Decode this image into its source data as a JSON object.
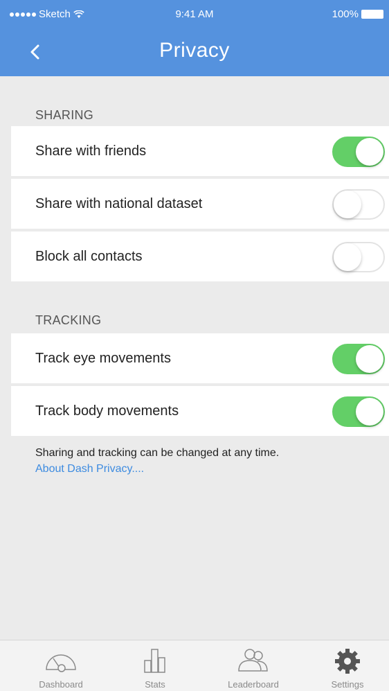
{
  "status_bar": {
    "carrier": "Sketch",
    "time": "9:41 AM",
    "battery": "100%"
  },
  "nav": {
    "back_icon": "chevron-left-icon",
    "title": "Privacy"
  },
  "sections": [
    {
      "header": "SHARING",
      "rows": [
        {
          "label": "Share with friends",
          "on": true
        },
        {
          "label": "Share with national dataset",
          "on": false
        },
        {
          "label": "Block all contacts",
          "on": false
        }
      ]
    },
    {
      "header": "TRACKING",
      "rows": [
        {
          "label": "Track eye movements",
          "on": true
        },
        {
          "label": "Track body movements",
          "on": true
        }
      ]
    }
  ],
  "footer": {
    "note": "Sharing and tracking can be changed at any time.",
    "link": "About Dash Privacy...."
  },
  "tabs": [
    {
      "label": "Dashboard",
      "icon": "gauge-icon"
    },
    {
      "label": "Stats",
      "icon": "bar-chart-icon"
    },
    {
      "label": "Leaderboard",
      "icon": "users-icon"
    },
    {
      "label": "Settings",
      "icon": "gear-icon",
      "active": true
    }
  ],
  "colors": {
    "header_blue": "#5592de",
    "toggle_green": "#63cf67",
    "link_blue": "#3d8be0"
  }
}
